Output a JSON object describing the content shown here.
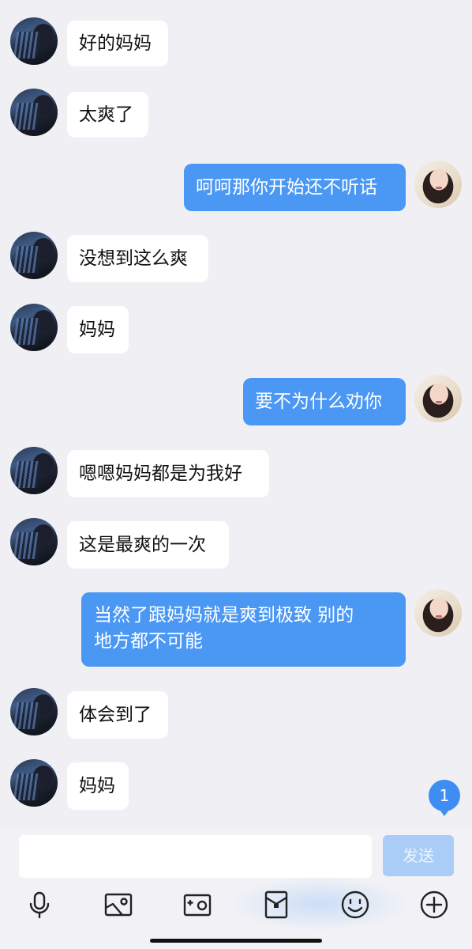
{
  "messages": [
    {
      "side": "in",
      "text": "好的妈妈"
    },
    {
      "side": "in",
      "text": "太爽了"
    },
    {
      "side": "out",
      "text": "呵呵那你开始还不听话"
    },
    {
      "side": "in",
      "text": "没想到这么爽"
    },
    {
      "side": "in",
      "text": "妈妈"
    },
    {
      "side": "out",
      "text": "要不为什么劝你"
    },
    {
      "side": "in",
      "text": "嗯嗯妈妈都是为我好"
    },
    {
      "side": "in",
      "text": "这是最爽的一次"
    },
    {
      "side": "out",
      "line1": "当然了跟妈妈就是爽到极致 别的",
      "line2": "地方都不可能"
    },
    {
      "side": "in",
      "text": "体会到了"
    },
    {
      "side": "in",
      "text": "妈妈"
    }
  ],
  "unread_badge": "1",
  "composer": {
    "input_value": "",
    "send_label": "发送"
  },
  "toolbar": {
    "icons": [
      "microphone-icon",
      "image-icon",
      "camera-icon",
      "red-packet-icon",
      "emoji-icon",
      "plus-icon"
    ]
  },
  "colors": {
    "background": "#efeff4",
    "outgoing_bubble": "#4a97f4",
    "incoming_bubble": "#ffffff",
    "send_button": "#a9cdf6"
  }
}
